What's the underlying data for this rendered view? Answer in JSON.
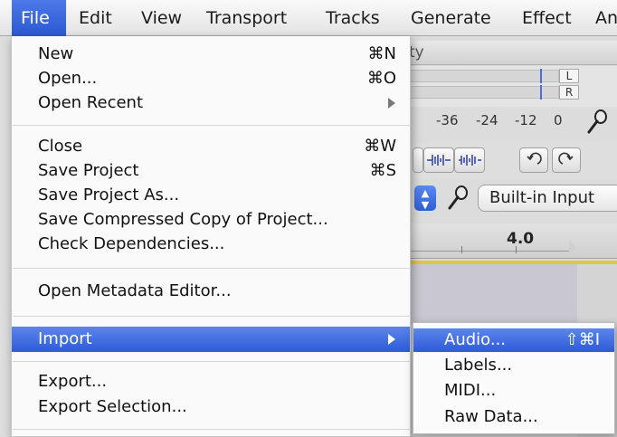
{
  "menubar": {
    "items": [
      "File",
      "Edit",
      "View",
      "Transport",
      "Tracks",
      "Generate",
      "Effect",
      "An"
    ],
    "active": "File"
  },
  "background": {
    "title_fragment": "ty",
    "meter_left": "L",
    "meter_right": "R",
    "scale_labels": [
      "-36",
      "-24",
      "-12",
      "0"
    ],
    "device_input": "Built-in Input",
    "timeline_label": "4.0",
    "stepper_up": "▲",
    "stepper_down": "▼"
  },
  "file_menu": {
    "items": [
      {
        "label": "New",
        "shortcut": "⌘N"
      },
      {
        "label": "Open...",
        "shortcut": "⌘O"
      },
      {
        "label": "Open Recent",
        "shortcut": ""
      },
      {
        "label": "Close",
        "shortcut": "⌘W"
      },
      {
        "label": "Save Project",
        "shortcut": "⌘S"
      },
      {
        "label": "Save Project As...",
        "shortcut": ""
      },
      {
        "label": "Save Compressed Copy of Project...",
        "shortcut": ""
      },
      {
        "label": "Check Dependencies...",
        "shortcut": ""
      },
      {
        "label": "Open Metadata Editor...",
        "shortcut": ""
      },
      {
        "label": "Import",
        "shortcut": ""
      },
      {
        "label": "Export...",
        "shortcut": ""
      },
      {
        "label": "Export Selection...",
        "shortcut": ""
      }
    ]
  },
  "import_submenu": {
    "items": [
      {
        "label": "Audio...",
        "shortcut": "⇧⌘I"
      },
      {
        "label": "Labels...",
        "shortcut": ""
      },
      {
        "label": "MIDI...",
        "shortcut": ""
      },
      {
        "label": "Raw Data...",
        "shortcut": ""
      }
    ]
  },
  "colors": {
    "highlight": "#3467de",
    "menu_bg": "#fafafa",
    "menubar_bg": "#eeeeee"
  }
}
